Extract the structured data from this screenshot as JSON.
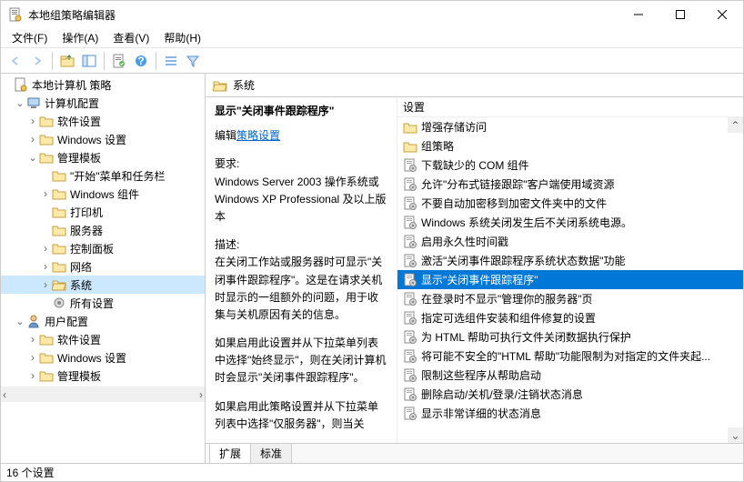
{
  "window": {
    "title": "本地组策略编辑器"
  },
  "menu": {
    "file": "文件(F)",
    "action": "操作(A)",
    "view": "查看(V)",
    "help": "帮助(H)"
  },
  "tree": {
    "root": "本地计算机 策略",
    "computer": "计算机配置",
    "software": "软件设置",
    "windows_settings": "Windows 设置",
    "admin_templates": "管理模板",
    "start_menu": "\"开始\"菜单和任务栏",
    "windows_components": "Windows 组件",
    "printers": "打印机",
    "servers": "服务器",
    "control_panel": "控制面板",
    "network": "网络",
    "system": "系统",
    "all_settings": "所有设置",
    "user": "用户配置",
    "u_software": "软件设置",
    "u_windows_settings": "Windows 设置",
    "u_admin_templates": "管理模板"
  },
  "header": {
    "title": "系统"
  },
  "detail": {
    "title": "显示\"关闭事件跟踪程序\"",
    "edit_prefix": "编辑",
    "edit_link": "策略设置",
    "req_label": "要求:",
    "req_text": "Windows Server 2003 操作系统或 Windows XP Professional 及以上版本",
    "desc_label": "描述:",
    "desc_p1": "在关闭工作站或服务器时可显示\"关闭事件跟踪程序\"。这是在请求关机时显示的一组额外的问题，用于收集与关机原因有关的信息。",
    "desc_p2": "如果启用此设置并从下拉菜单列表中选择\"始终显示\"，则在关闭计算机时会显示\"关闭事件跟踪程序\"。",
    "desc_p3": "如果启用此策略设置并从下拉菜单列表中选择\"仅服务器\"，则当关"
  },
  "list_header": "设置",
  "list": [
    {
      "type": "folder",
      "label": "增强存储访问"
    },
    {
      "type": "folder",
      "label": "组策略"
    },
    {
      "type": "setting",
      "label": "下载缺少的 COM 组件"
    },
    {
      "type": "setting",
      "label": "允许\"分布式链接跟踪\"客户端使用域资源"
    },
    {
      "type": "setting",
      "label": "不要自动加密移到加密文件夹中的文件"
    },
    {
      "type": "setting",
      "label": "Windows 系统关闭发生后不关闭系统电源。"
    },
    {
      "type": "setting",
      "label": "启用永久性时间戳"
    },
    {
      "type": "setting",
      "label": "激活\"关闭事件跟踪程序系统状态数据\"功能"
    },
    {
      "type": "setting",
      "label": "显示\"关闭事件跟踪程序\"",
      "selected": true
    },
    {
      "type": "setting",
      "label": "在登录时不显示\"管理你的服务器\"页"
    },
    {
      "type": "setting",
      "label": "指定可选组件安装和组件修复的设置"
    },
    {
      "type": "setting",
      "label": "为 HTML 帮助可执行文件关闭数据执行保护"
    },
    {
      "type": "setting",
      "label": "将可能不安全的\"HTML 帮助\"功能限制为对指定的文件夹起..."
    },
    {
      "type": "setting",
      "label": "限制这些程序从帮助启动"
    },
    {
      "type": "setting",
      "label": "删除启动/关机/登录/注销状态消息"
    },
    {
      "type": "setting",
      "label": "显示非常详细的状态消息"
    }
  ],
  "tabs": {
    "extended": "扩展",
    "standard": "标准"
  },
  "status": "16 个设置"
}
